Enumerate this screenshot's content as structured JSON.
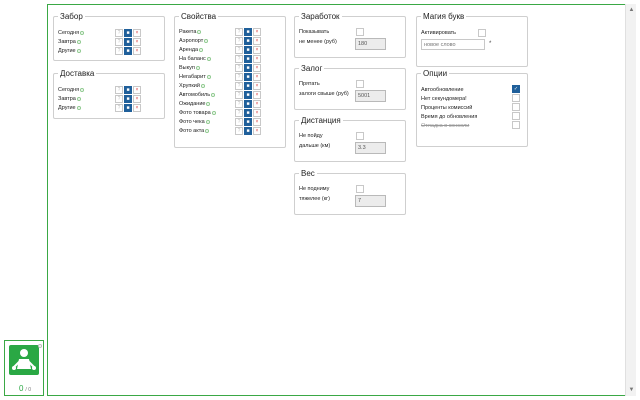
{
  "zabor": {
    "title": "Забор",
    "rows": [
      {
        "label": "Сегодня",
        "state": "on"
      },
      {
        "label": "Завтра",
        "state": "on"
      },
      {
        "label": "Другие",
        "state": "on"
      }
    ]
  },
  "dostavka": {
    "title": "Доставка",
    "rows": [
      {
        "label": "Сегодня",
        "state": "on"
      },
      {
        "label": "Завтра",
        "state": "on"
      },
      {
        "label": "Другие",
        "state": "on"
      }
    ]
  },
  "svoystva": {
    "title": "Свойства",
    "rows": [
      {
        "label": "Ракета"
      },
      {
        "label": "Аэропорт"
      },
      {
        "label": "Аренда"
      },
      {
        "label": "На баланс"
      },
      {
        "label": "Выкуп"
      },
      {
        "label": "Негабарит"
      },
      {
        "label": "Хрупкий"
      },
      {
        "label": "Автомобиль"
      },
      {
        "label": "Ожидание"
      },
      {
        "label": "Фото товара"
      },
      {
        "label": "Фото чека"
      },
      {
        "label": "Фото акта"
      }
    ]
  },
  "tri_glyphs": {
    "q": "?",
    "on": "■",
    "x": "×"
  },
  "zarabotok": {
    "title": "Заработок",
    "show_label": "Показывать",
    "min_label": "не менее (руб)",
    "min_value": "180"
  },
  "zalog": {
    "title": "Залог",
    "hide_label": "Прятать",
    "more_label": "залоги свыше (руб)",
    "more_value": "5001"
  },
  "distance": {
    "title": "Дистанция",
    "no_go_label": "Не пойду",
    "further_label": "дальше (км)",
    "further_value": "3.3"
  },
  "ves": {
    "title": "Вес",
    "no_lift_label": "Не подниму",
    "heavier_label": "тяжелее (кг)",
    "heavier_value": "7"
  },
  "magic": {
    "title": "Магия букв",
    "activate_label": "Активировать",
    "word_placeholder": "новое слово",
    "asterisk": "*"
  },
  "options": {
    "title": "Опции",
    "items": [
      {
        "label": "Автообновление",
        "checked": true,
        "strike": false
      },
      {
        "label": "Нет секундомера!",
        "checked": false,
        "strike": false
      },
      {
        "label": "Проценты комиссий",
        "checked": false,
        "strike": false
      },
      {
        "label": "Время до обновления",
        "checked": false,
        "strike": false
      },
      {
        "label": "Отладка в консоли",
        "checked": false,
        "strike": true
      }
    ]
  },
  "extension": {
    "counter_main": "0",
    "counter_sub": "/ 0"
  },
  "colors": {
    "accent_green": "#2aa844",
    "selected_blue": "#1f5f9a"
  }
}
